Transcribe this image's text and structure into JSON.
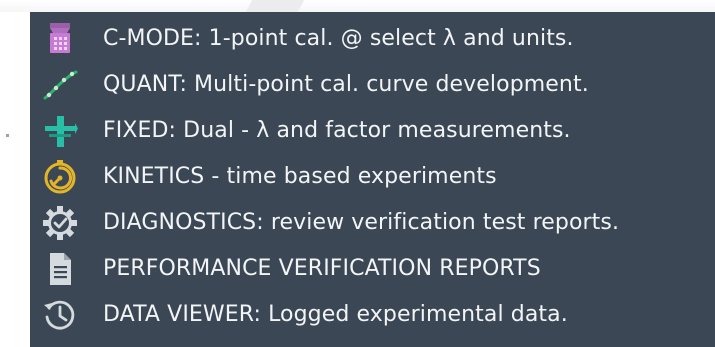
{
  "menu": {
    "items": [
      {
        "label": "C-MODE: 1-point cal. @ select λ and units.",
        "icon": "c-mode-icon"
      },
      {
        "label": "QUANT: Multi-point cal. curve development.",
        "icon": "calibration-curve-icon"
      },
      {
        "label": "FIXED: Dual - λ and factor measurements.",
        "icon": "fixed-dual-icon"
      },
      {
        "label": "KINETICS - time based experiments",
        "icon": "stopwatch-icon"
      },
      {
        "label": "DIAGNOSTICS: review verification test reports.",
        "icon": "gear-check-icon"
      },
      {
        "label": "PERFORMANCE VERIFICATION REPORTS",
        "icon": "document-icon"
      },
      {
        "label": "DATA VIEWER: Logged experimental data.",
        "icon": "history-clock-icon"
      }
    ]
  },
  "colors": {
    "panel": "#3b4754",
    "text": "#f2f4f6",
    "c_mode_icon": "#c77ad6",
    "quant_icon": "#2fb36b",
    "fixed_icon": "#27bfa5",
    "kinetics_icon": "#e4b528",
    "neutral_icon": "#d5dadf"
  }
}
